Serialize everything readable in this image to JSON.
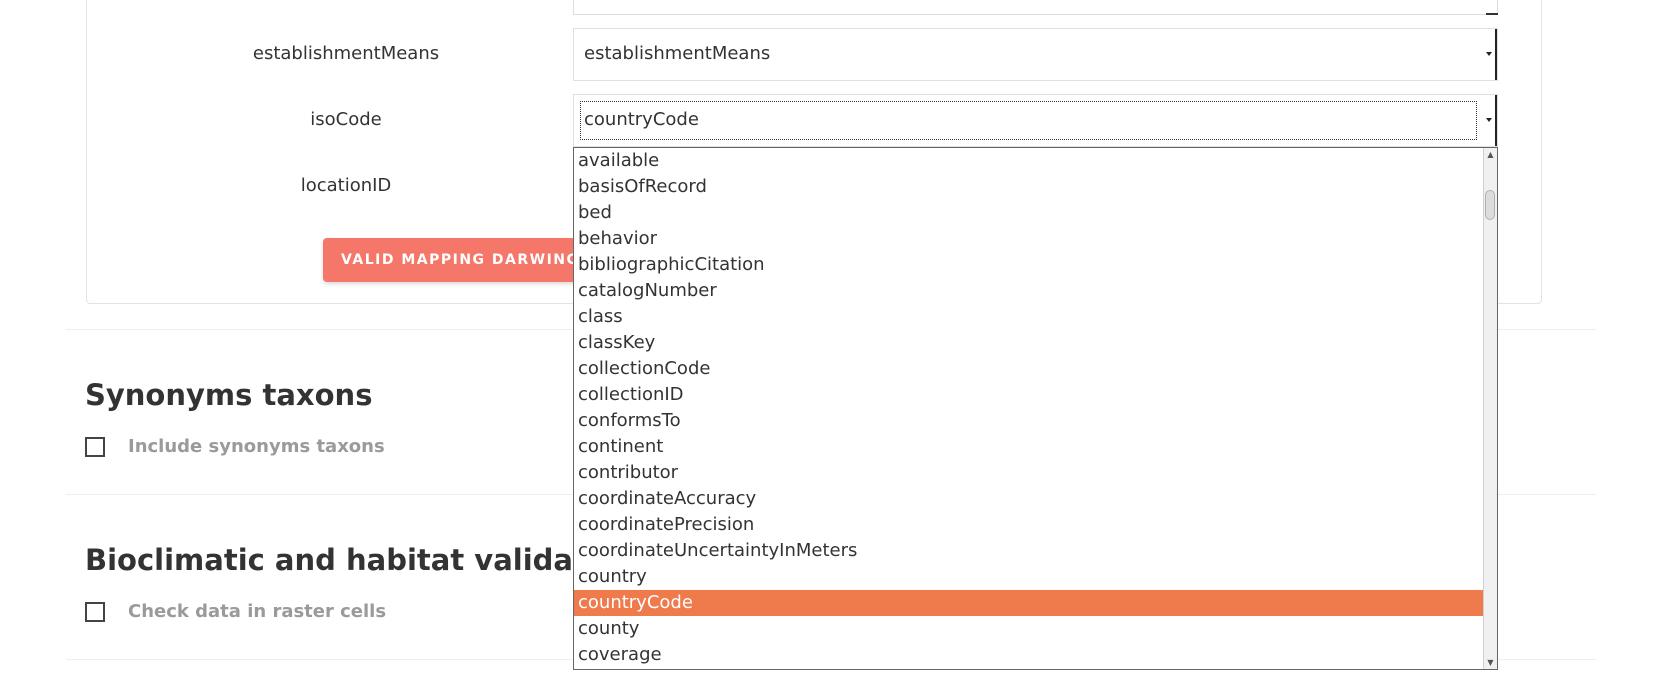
{
  "mapping": {
    "rows": [
      {
        "label": "establishmentMeans",
        "value": "establishmentMeans"
      },
      {
        "label": "isoCode",
        "value": "countryCode"
      },
      {
        "label": "locationID",
        "value": ""
      }
    ],
    "valid_button_label": "VALID MAPPING DARWINCO"
  },
  "dropdown": {
    "options": [
      "available",
      "basisOfRecord",
      "bed",
      "behavior",
      "bibliographicCitation",
      "catalogNumber",
      "class",
      "classKey",
      "collectionCode",
      "collectionID",
      "conformsTo",
      "continent",
      "contributor",
      "coordinateAccuracy",
      "coordinatePrecision",
      "coordinateUncertaintyInMeters",
      "country",
      "countryCode",
      "county",
      "coverage"
    ],
    "selected": "countryCode",
    "scroll_up_icon": "▲",
    "scroll_down_icon": "▼"
  },
  "sections": {
    "synonyms": {
      "title": "Synonyms taxons",
      "checkbox_label": "Include synonyms taxons",
      "checked": false
    },
    "bioclimatic": {
      "title": "Bioclimatic and habitat validation",
      "checkbox_label": "Check data in raster cells",
      "checked": false
    }
  },
  "colors": {
    "button": "#f4776a",
    "selected_option": "#ef7a4c"
  }
}
